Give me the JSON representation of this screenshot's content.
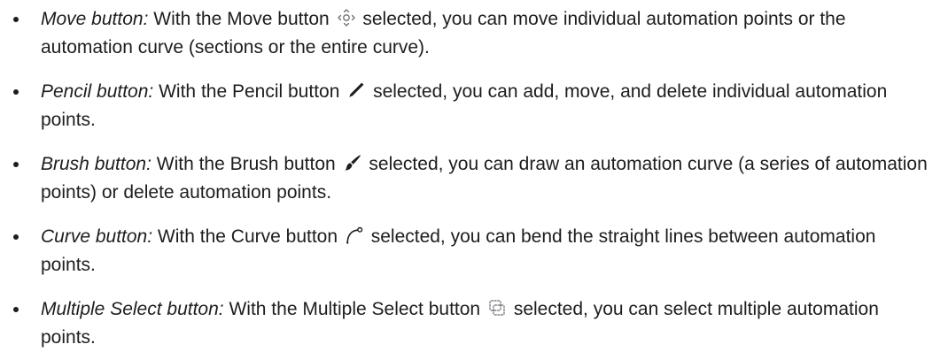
{
  "items": [
    {
      "term": "Move button:",
      "before": "With the Move button",
      "icon": "move-icon",
      "after": "selected, you can move individual automation points or the automation curve (sections or the entire curve)."
    },
    {
      "term": "Pencil button:",
      "before": "With the Pencil button",
      "icon": "pencil-icon",
      "after": "selected, you can add, move, and delete individual automation points."
    },
    {
      "term": "Brush button:",
      "before": "With the Brush button",
      "icon": "brush-icon",
      "after": "selected, you can draw an automation curve (a series of automation points) or delete automation points."
    },
    {
      "term": "Curve button:",
      "before": "With the Curve button",
      "icon": "curve-icon",
      "after": "selected, you can bend the straight lines between automation points."
    },
    {
      "term": "Multiple Select button:",
      "before": "With the Multiple Select button",
      "icon": "multiple-select-icon",
      "after": "selected, you can select multiple automation points."
    }
  ]
}
